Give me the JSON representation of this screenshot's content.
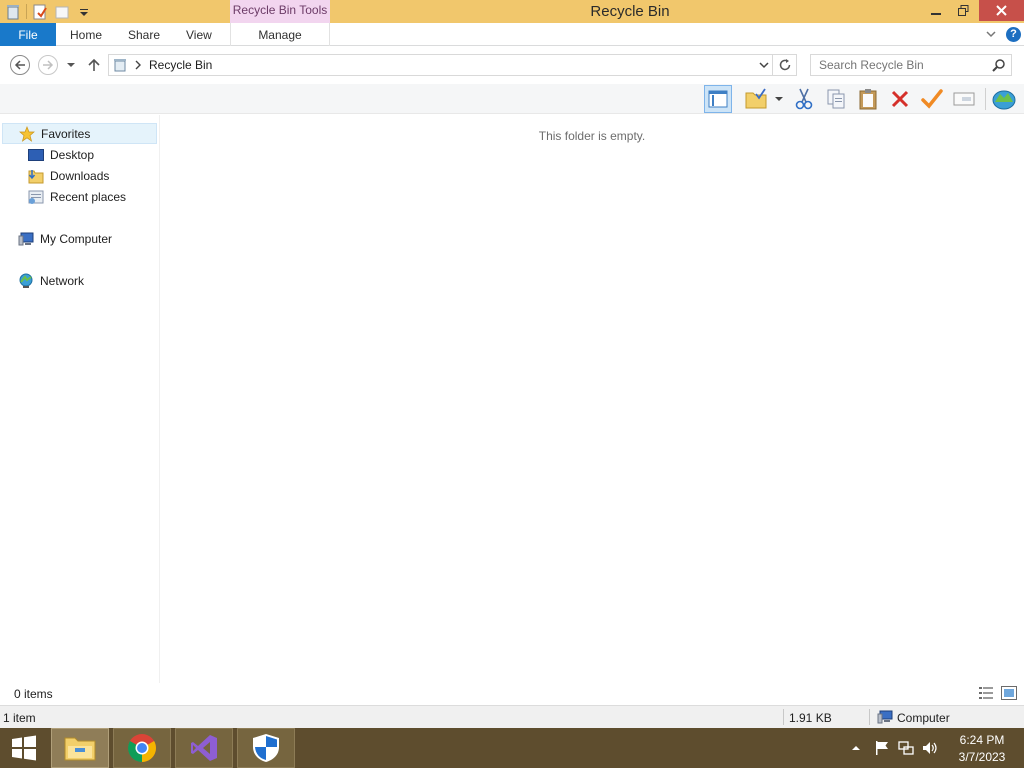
{
  "window": {
    "title": "Recycle Bin",
    "context_tab": "Recycle Bin Tools"
  },
  "ribbon": {
    "tabs": [
      "File",
      "Home",
      "Share",
      "View",
      "Manage"
    ],
    "help": "?"
  },
  "address": {
    "path": "Recycle Bin",
    "search_placeholder": "Search Recycle Bin"
  },
  "toolbar": {
    "buttons": [
      "preview-pane",
      "new-folder",
      "cut",
      "copy",
      "paste",
      "delete",
      "properties-check",
      "rename",
      "globe"
    ]
  },
  "nav": {
    "favorites": "Favorites",
    "desktop": "Desktop",
    "downloads": "Downloads",
    "recent": "Recent places",
    "computer": "My Computer",
    "network": "Network"
  },
  "content": {
    "empty_message": "This folder is empty."
  },
  "status": {
    "items": "0 items"
  },
  "details": {
    "count": "1 item",
    "size": "1.91 KB",
    "location": "Computer"
  },
  "taskbar": {
    "apps": [
      "File Explorer",
      "Google Chrome",
      "Visual Studio",
      "Windows Defender"
    ],
    "time": "6:24 PM",
    "date": "3/7/2023"
  },
  "colors": {
    "title_bar": "#f1c76c",
    "file_tab": "#1979ca",
    "close_button": "#c7504a",
    "context_tab": "#f2d5ef",
    "taskbar": "#5e4d2e"
  }
}
